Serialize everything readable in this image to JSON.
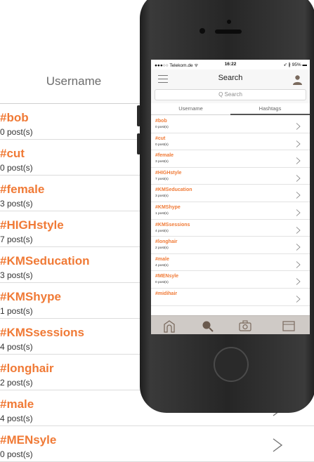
{
  "background": {
    "header": "Username",
    "rows": [
      {
        "tag": "#bob",
        "count": "0 post(s)"
      },
      {
        "tag": "#cut",
        "count": "0 post(s)"
      },
      {
        "tag": "#female",
        "count": "3 post(s)"
      },
      {
        "tag": "#HIGHstyle",
        "count": "7 post(s)"
      },
      {
        "tag": "#KMSeducation",
        "count": "3 post(s)"
      },
      {
        "tag": "#KMShype",
        "count": "1 post(s)"
      },
      {
        "tag": "#KMSsessions",
        "count": "4 post(s)"
      },
      {
        "tag": "#longhair",
        "count": "2 post(s)"
      },
      {
        "tag": "#male",
        "count": "4 post(s)"
      },
      {
        "tag": "#MENsyle",
        "count": "0 post(s)"
      }
    ]
  },
  "status": {
    "carrier": "●●●○○ Telekom.de ᯤ",
    "time": "16:22",
    "battery": "➶ ∦ 95% ▬"
  },
  "nav": {
    "title": "Search",
    "left_icon": "menu-icon",
    "right_icon": "user-icon"
  },
  "search": {
    "placeholder": "Q Search"
  },
  "tabs": {
    "username": "Username",
    "hashtags": "Hashtags"
  },
  "list": [
    {
      "tag": "#bob",
      "count": "0 post(s)"
    },
    {
      "tag": "#cut",
      "count": "0 post(s)"
    },
    {
      "tag": "#female",
      "count": "3 post(s)"
    },
    {
      "tag": "#HIGHstyle",
      "count": "7 post(s)"
    },
    {
      "tag": "#KMSeducation",
      "count": "3 post(s)"
    },
    {
      "tag": "#KMShype",
      "count": "1 post(s)"
    },
    {
      "tag": "#KMSsessions",
      "count": "4 post(s)"
    },
    {
      "tag": "#longhair",
      "count": "2 post(s)"
    },
    {
      "tag": "#male",
      "count": "4 post(s)"
    },
    {
      "tag": "#MENsyle",
      "count": "0 post(s)"
    },
    {
      "tag": "#midihair",
      "count": ""
    }
  ],
  "toolbar": {
    "icons": [
      "home-icon",
      "search-icon",
      "camera-icon",
      "inbox-icon"
    ]
  },
  "colors": {
    "accent": "#f07a36",
    "toolbar": "#cfcac6"
  }
}
